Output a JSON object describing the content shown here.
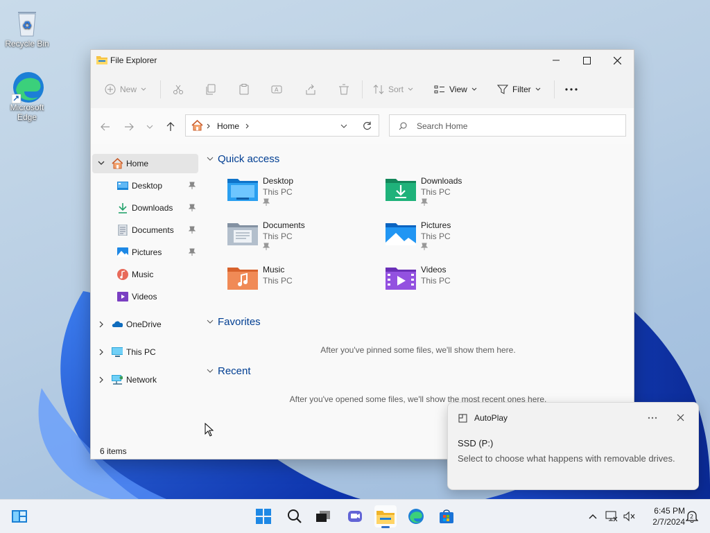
{
  "desktop": {
    "icons": [
      {
        "label": "Recycle Bin",
        "icon": "recycle-bin-icon"
      },
      {
        "label": "Microsoft Edge",
        "icon": "edge-icon"
      }
    ]
  },
  "window": {
    "title": "File Explorer",
    "toolbar": {
      "new": "New",
      "sort": "Sort",
      "view": "View",
      "filter": "Filter"
    },
    "address": {
      "home": "Home"
    },
    "search": {
      "placeholder": "Search Home"
    },
    "sidebar": {
      "home": "Home",
      "pinned": [
        "Desktop",
        "Downloads",
        "Documents",
        "Pictures"
      ],
      "unpinned": [
        "Music",
        "Videos"
      ],
      "onedrive": "OneDrive",
      "thispc": "This PC",
      "network": "Network"
    },
    "sections": {
      "quick_access": "Quick access",
      "favorites": "Favorites",
      "recent": "Recent"
    },
    "quick_access": [
      {
        "name": "Desktop",
        "location": "This PC",
        "icon": "desktop-folder-icon"
      },
      {
        "name": "Downloads",
        "location": "This PC",
        "icon": "downloads-folder-icon"
      },
      {
        "name": "Documents",
        "location": "This PC",
        "icon": "documents-folder-icon"
      },
      {
        "name": "Pictures",
        "location": "This PC",
        "icon": "pictures-folder-icon"
      },
      {
        "name": "Music",
        "location": "This PC",
        "icon": "music-folder-icon"
      },
      {
        "name": "Videos",
        "location": "This PC",
        "icon": "videos-folder-icon"
      }
    ],
    "favorites_empty": "After you've pinned some files, we'll show them here.",
    "recent_empty": "After you've opened some files, we'll show the most recent ones here.",
    "status": "6 items"
  },
  "toast": {
    "app": "AutoPlay",
    "device": "SSD (P:)",
    "message": "Select to choose what happens with removable drives."
  },
  "taskbar": {
    "time": "6:45 PM",
    "date": "2/7/2024"
  },
  "colors": {
    "accent": "#005fb8",
    "section_header": "#003e92",
    "selection": "#e5e5e5"
  }
}
